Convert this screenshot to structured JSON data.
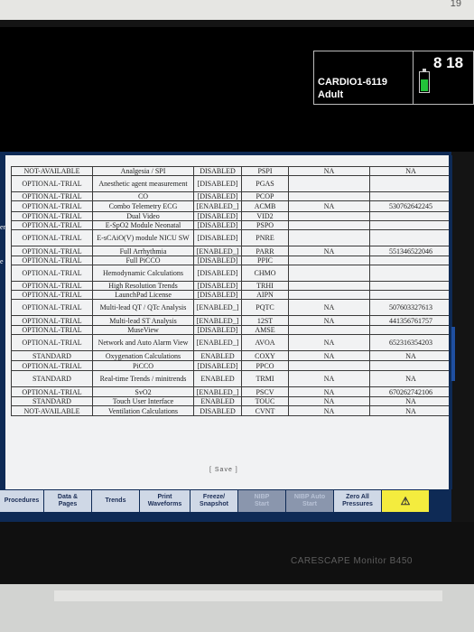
{
  "corner_number": "19",
  "patient": {
    "id": "CARDIO1-6119",
    "type": "Adult"
  },
  "clock": "8 18",
  "colors": {
    "screen_bg": "#0e2a55",
    "battery_fill": "#22c33a",
    "alarm_button": "#f4ec3e"
  },
  "left_edge_labels": [
    "ent",
    "e"
  ],
  "table": {
    "rows": [
      {
        "status": "NOT-AVAILABLE",
        "description": "Analgesia / SPI",
        "state": "DISABLED",
        "code": "PSPI",
        "col5": "NA",
        "col6": "NA"
      },
      {
        "status": "OPTIONAL-TRIAL",
        "description": "Anesthetic agent measurement",
        "state": "[DISABLED]",
        "code": "PGAS",
        "col5": "",
        "col6": ""
      },
      {
        "status": "OPTIONAL-TRIAL",
        "description": "CO",
        "state": "[DISABLED]",
        "code": "PCOP",
        "col5": "",
        "col6": ""
      },
      {
        "status": "OPTIONAL-TRIAL",
        "description": "Combo Telemetry ECG",
        "state": "[ENABLED_]",
        "code": "ACMB",
        "col5": "NA",
        "col6": "530762642245"
      },
      {
        "status": "OPTIONAL-TRIAL",
        "description": "Dual Video",
        "state": "[DISABLED]",
        "code": "VID2",
        "col5": "",
        "col6": ""
      },
      {
        "status": "OPTIONAL-TRIAL",
        "description": "E-SpO2 Module Neonatal",
        "state": "[DISABLED]",
        "code": "PSPO",
        "col5": "",
        "col6": ""
      },
      {
        "status": "OPTIONAL-TRIAL",
        "description": "E-sCAiO(V) module NICU SW",
        "state": "[DISABLED]",
        "code": "PNRE",
        "col5": "",
        "col6": ""
      },
      {
        "status": "OPTIONAL-TRIAL",
        "description": "Full Arrhythmia",
        "state": "[ENABLED_]",
        "code": "PARR",
        "col5": "NA",
        "col6": "551346522046"
      },
      {
        "status": "OPTIONAL-TRIAL",
        "description": "Full PiCCO",
        "state": "[DISABLED]",
        "code": "PPIC",
        "col5": "",
        "col6": ""
      },
      {
        "status": "OPTIONAL-TRIAL",
        "description": "Hemodynamic Calculations",
        "state": "[DISABLED]",
        "code": "CHMO",
        "col5": "",
        "col6": ""
      },
      {
        "status": "OPTIONAL-TRIAL",
        "description": "High Resolution Trends",
        "state": "[DISABLED]",
        "code": "TRHI",
        "col5": "",
        "col6": ""
      },
      {
        "status": "OPTIONAL-TRIAL",
        "description": "LaunchPad License",
        "state": "[DISABLED]",
        "code": "AIPN",
        "col5": "",
        "col6": ""
      },
      {
        "status": "OPTIONAL-TRIAL",
        "description": "Multi-lead QT / QTc Analysis",
        "state": "[ENABLED_]",
        "code": "PQTC",
        "col5": "NA",
        "col6": "507603327613"
      },
      {
        "status": "OPTIONAL-TRIAL",
        "description": "Multi-lead ST Analysis",
        "state": "[ENABLED_]",
        "code": "12ST",
        "col5": "NA",
        "col6": "441356761757"
      },
      {
        "status": "OPTIONAL-TRIAL",
        "description": "MuseView",
        "state": "[DISABLED]",
        "code": "AMSE",
        "col5": "",
        "col6": ""
      },
      {
        "status": "OPTIONAL-TRIAL",
        "description": "Network and Auto Alarm View",
        "state": "[ENABLED_]",
        "code": "AVOA",
        "col5": "NA",
        "col6": "652316354203"
      },
      {
        "status": "STANDARD",
        "description": "Oxygenation Calculations",
        "state": "ENABLED",
        "code": "COXY",
        "col5": "NA",
        "col6": "NA"
      },
      {
        "status": "OPTIONAL-TRIAL",
        "description": "PiCCO",
        "state": "[DISABLED]",
        "code": "PPCO",
        "col5": "",
        "col6": ""
      },
      {
        "status": "STANDARD",
        "description": "Real-time Trends / minitrends",
        "state": "ENABLED",
        "code": "TRMI",
        "col5": "NA",
        "col6": "NA"
      },
      {
        "status": "OPTIONAL-TRIAL",
        "description": "SvO2",
        "state": "[ENABLED_]",
        "code": "PSCV",
        "col5": "NA",
        "col6": "670262742106"
      },
      {
        "status": "STANDARD",
        "description": "Touch User Interface",
        "state": "ENABLED",
        "code": "TOUC",
        "col5": "NA",
        "col6": "NA"
      },
      {
        "status": "NOT-AVAILABLE",
        "description": "Ventilation Calculations",
        "state": "DISABLED",
        "code": "CVNT",
        "col5": "NA",
        "col6": "NA"
      }
    ]
  },
  "save_label": "[ Save ]",
  "toolbar": [
    {
      "label": "Procedures",
      "disabled": false
    },
    {
      "label": "Data &\nPages",
      "disabled": false
    },
    {
      "label": "Trends",
      "disabled": false
    },
    {
      "label": "Print\nWaveforms",
      "disabled": false
    },
    {
      "label": "Freeze/\nSnapshot",
      "disabled": false
    },
    {
      "label": "NIBP\nStart",
      "disabled": true
    },
    {
      "label": "NIBP Auto\nStart",
      "disabled": true
    },
    {
      "label": "Zero All\nPressures",
      "disabled": false
    },
    {
      "label": "⚠",
      "disabled": false,
      "alarm": true
    }
  ],
  "brand": "CARESCAPE Monitor B450"
}
